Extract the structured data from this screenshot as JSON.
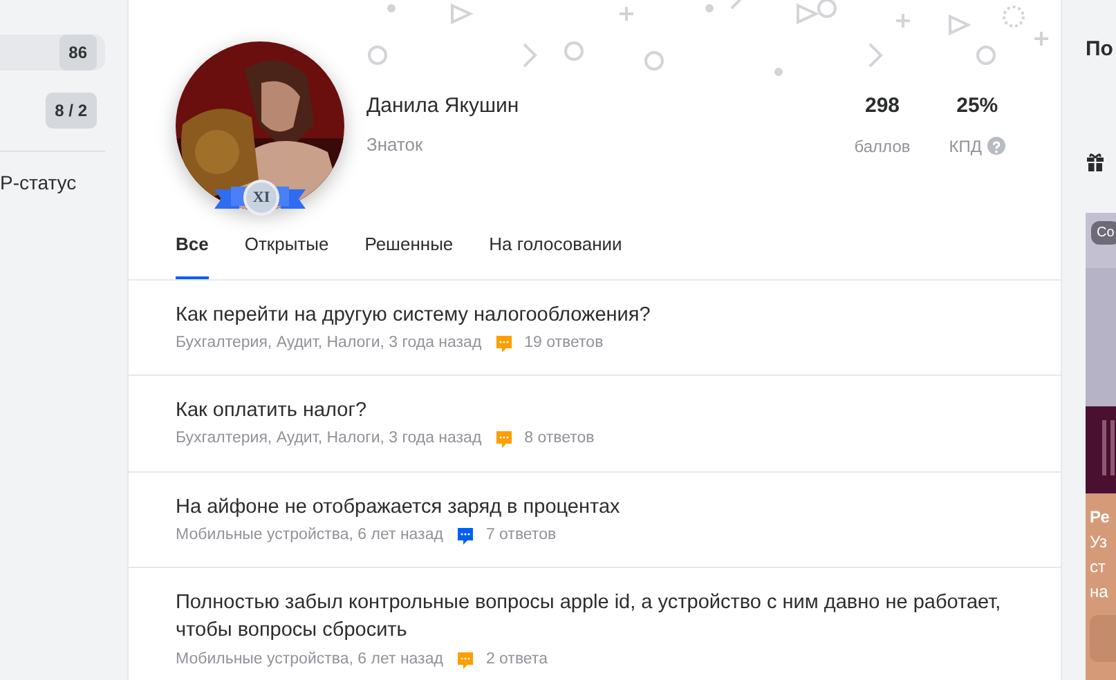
{
  "left_sidebar": {
    "items": [
      {
        "badge": "86",
        "selected": true
      },
      {
        "badge": "8 / 2",
        "selected": false
      }
    ],
    "link": "P-статус"
  },
  "profile": {
    "name": "Данила Якушин",
    "rank": "Знаток",
    "level_badge": "XI",
    "stats": [
      {
        "value": "298",
        "label": "баллов",
        "help": false
      },
      {
        "value": "25%",
        "label": "КПД",
        "help": true
      }
    ]
  },
  "tabs": [
    {
      "label": "Все",
      "selected": true
    },
    {
      "label": "Открытые",
      "selected": false
    },
    {
      "label": "Решенные",
      "selected": false
    },
    {
      "label": "На голосовании",
      "selected": false
    }
  ],
  "questions": [
    {
      "title": "Как перейти на другую систему налогообложения?",
      "meta": "Бухгалтерия, Аудит, Налоги, 3 года назад",
      "answers": "19 ответов",
      "color": "#ff9e00"
    },
    {
      "title": "Как оплатить налог?",
      "meta": "Бухгалтерия, Аудит, Налоги, 3 года назад",
      "answers": "8 ответов",
      "color": "#ff9e00"
    },
    {
      "title": "На айфоне не отображается заряд в процентах",
      "meta": "Мобильные устройства, 6 лет назад",
      "answers": "7 ответов",
      "color": "#005ff9"
    },
    {
      "title": "Полностью забыл контрольные вопросы apple id, а устройство с ним давно не работает, чтобы вопросы сбросить",
      "meta": "Мобильные устройства, 6 лет назад",
      "answers": "2 ответа",
      "color": "#ff9e00"
    }
  ],
  "right_sidebar": {
    "heading": "По",
    "ad": {
      "tag": "Co",
      "title": "Ре",
      "lines": [
        "Уз",
        "ст",
        "на"
      ]
    }
  }
}
